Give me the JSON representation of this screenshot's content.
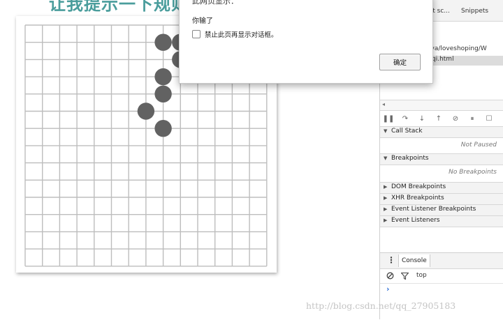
{
  "page": {
    "heading": "让我提示一下规则说明了它"
  },
  "dialog": {
    "title": "此网页显示：",
    "message": "你输了",
    "suppress_label": "禁止此页再显示对话框。",
    "ok_label": "确定"
  },
  "board": {
    "rows": 14,
    "cols": 14,
    "black_stones": [
      [
        8,
        1
      ],
      [
        9,
        1
      ],
      [
        9,
        2
      ],
      [
        8,
        3
      ],
      [
        8,
        4
      ],
      [
        7,
        5
      ],
      [
        8,
        6
      ]
    ],
    "stone_color": "#626262"
  },
  "devtools": {
    "tabs_partial": "ent sc...",
    "snippets_tab": "Snippets",
    "file_path": "ajava/loveshoping/W",
    "file_selected": "qi.html",
    "call_stack": {
      "label": "Call Stack",
      "status": "Not Paused"
    },
    "breakpoints": {
      "label": "Breakpoints",
      "status": "No Breakpoints"
    },
    "collapsed_sections": [
      "DOM Breakpoints",
      "XHR Breakpoints",
      "Event Listener Breakpoints",
      "Event Listeners"
    ],
    "console": {
      "tab": "Console",
      "context": "top"
    }
  },
  "watermark": "http://blog.csdn.net/qq_27905183"
}
